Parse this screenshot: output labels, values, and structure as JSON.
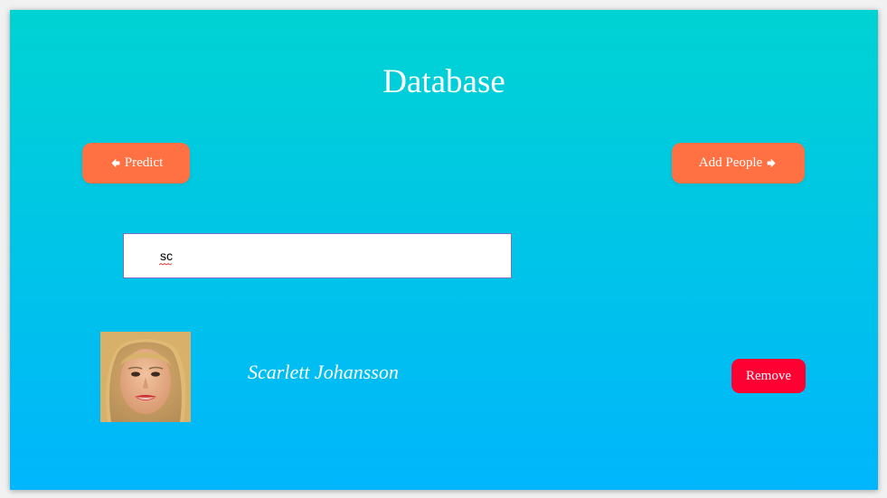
{
  "page": {
    "title": "Database"
  },
  "nav": {
    "predict_label": "Predict",
    "add_people_label": "Add People",
    "button_color": "#ff7043"
  },
  "search": {
    "value": "sc"
  },
  "results": [
    {
      "name": "Scarlett Johansson",
      "remove_label": "Remove"
    }
  ],
  "colors": {
    "gradient_top": "#00d3d3",
    "gradient_bottom": "#00b6fc",
    "remove": "#ff0033",
    "text": "#ffffff"
  },
  "icons": {
    "predict": "arrow-left-icon",
    "add_people": "arrow-right-icon"
  }
}
